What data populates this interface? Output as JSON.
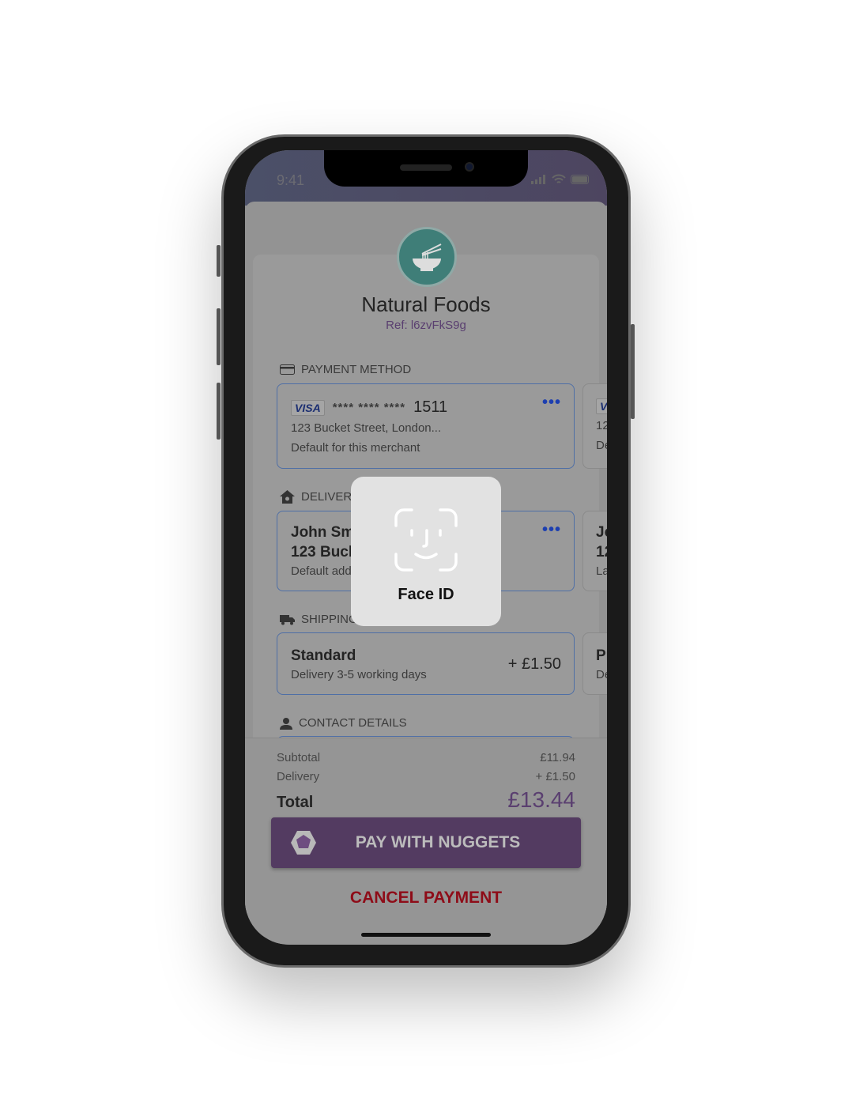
{
  "status": {
    "time": "9:41"
  },
  "merchant": {
    "name": "Natural Foods",
    "ref": "Ref: l6zvFkS9g",
    "logo_icon": "noodle-bowl-icon",
    "brand_color": "#3f7e78"
  },
  "payment": {
    "label": "PAYMENT METHOD",
    "card": {
      "brand": "VISA",
      "number": "**** **** ****",
      "last4": "1511",
      "address": "123 Bucket Street, London...",
      "note": "Default for this merchant"
    },
    "next_card": {
      "brand": "V",
      "line1": "12",
      "line2": "De"
    }
  },
  "delivery": {
    "label": "DELIVERY",
    "card": {
      "name": "John Sm",
      "address": "123 Buck",
      "note": "Default add"
    },
    "next_card": {
      "line1": "Jo",
      "line2": "12",
      "line3": "La"
    }
  },
  "shipping": {
    "label": "SHIPPING",
    "card": {
      "title": "Standard",
      "desc": "Delivery 3-5 working days",
      "price": "+ £1.50"
    },
    "next_card": {
      "line1": "Pr",
      "line2": "De"
    }
  },
  "contact": {
    "label": "CONTACT DETAILS"
  },
  "summary": {
    "subtotal_label": "Subtotal",
    "subtotal": "£11.94",
    "delivery_label": "Delivery",
    "delivery": "+ £1.50",
    "total_label": "Total",
    "total": "£13.44"
  },
  "actions": {
    "pay": "PAY WITH NUGGETS",
    "cancel": "CANCEL PAYMENT"
  },
  "faceid": {
    "label": "Face ID"
  },
  "colors": {
    "accent": "#533b61",
    "cancel": "#8e0c18",
    "card_border": "#4f6fa6"
  }
}
